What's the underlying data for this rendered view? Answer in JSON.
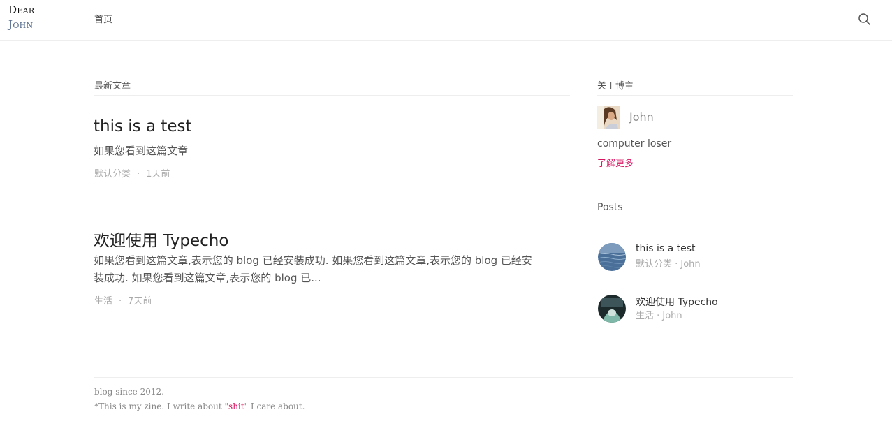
{
  "header": {
    "logo_line1": "Dear",
    "logo_line2": "John",
    "nav_home": "首页",
    "search_icon": "search-icon"
  },
  "main": {
    "section_title": "最新文章",
    "posts": [
      {
        "title": "this is a test",
        "excerpt": "如果您看到这篇文章",
        "category": "默认分类",
        "separator": "·",
        "time": "1天前"
      },
      {
        "title": "欢迎使用 Typecho",
        "excerpt_line1": "如果您看到这篇文章,表示您的 blog 已经安装成功. 如果您看到这篇文章,表示您的 blog 已经安",
        "excerpt_line2": "装成功. 如果您看到这篇文章,表示您的 blog 已...",
        "category": "生活",
        "separator": "·",
        "time": "7天前"
      }
    ]
  },
  "sidebar": {
    "about_title": "关于博主",
    "author_name": "John",
    "author_desc": "computer loser",
    "learn_more": "了解更多",
    "posts_title": "Posts",
    "posts": [
      {
        "title": "this is a test",
        "meta": "默认分类 · John"
      },
      {
        "title": "欢迎使用 Typecho",
        "meta": "生活 · John"
      }
    ]
  },
  "footer": {
    "line1": "blog since 2012.",
    "line2_prefix": "*This is my zine. I write about \"",
    "line2_highlight": "shit",
    "line2_suffix": "\" I care about."
  },
  "colors": {
    "accent": "#d8145f",
    "logo_secondary": "#5a6f90",
    "meta_text": "#aaaaaa",
    "divider": "#eeeeee"
  }
}
